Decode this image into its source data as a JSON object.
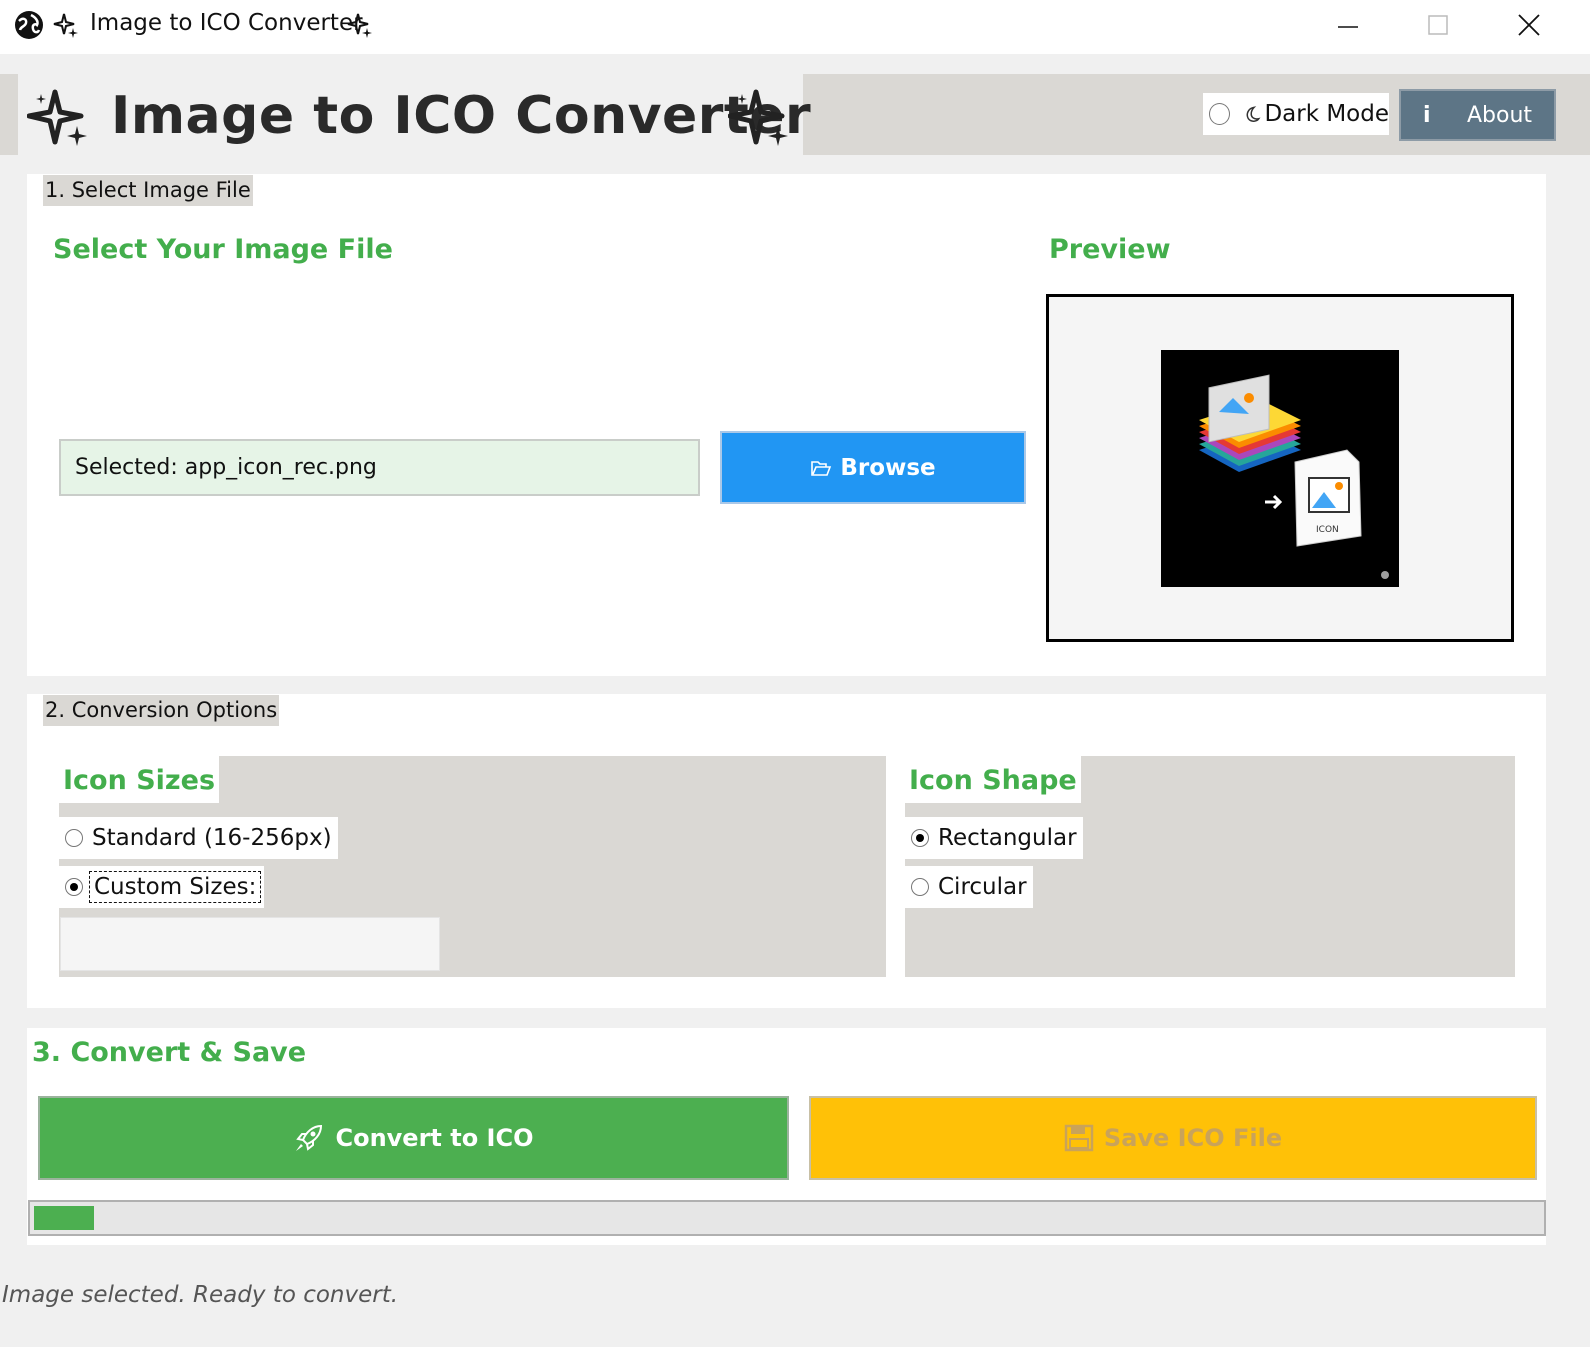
{
  "window": {
    "title": "Image to ICO Converter",
    "title_icon": "sparkle-icon",
    "app_icon": "globe-icon"
  },
  "header": {
    "title": "Image to ICO Converter",
    "dark_mode_label": "Dark Mode",
    "dark_mode_on": false,
    "about_icon_glyph": "i",
    "about_label": "About"
  },
  "section1": {
    "label": "1. Select Image File",
    "heading": "Select Your Image File",
    "file_field_value": "Selected: app_icon_rec.png",
    "browse_label": "Browse",
    "browse_icon": "folder-icon",
    "preview_heading": "Preview",
    "preview_icon_text": "ICON"
  },
  "section2": {
    "label": "2. Conversion Options",
    "sizes_heading": "Icon Sizes",
    "sizes_options": [
      {
        "label": "Standard (16-256px)",
        "selected": false
      },
      {
        "label": "Custom Sizes:",
        "selected": true
      }
    ],
    "custom_sizes_value": "",
    "shape_heading": "Icon Shape",
    "shape_options": [
      {
        "label": "Rectangular",
        "selected": true
      },
      {
        "label": "Circular",
        "selected": false
      }
    ]
  },
  "section3": {
    "heading": "3. Convert & Save",
    "convert_label": "Convert to ICO",
    "convert_icon": "rocket-icon",
    "save_label": "Save ICO File",
    "save_icon": "floppy-icon",
    "progress_fraction": 0.04
  },
  "status": "Image selected. Ready to convert.",
  "colors": {
    "accent_green": "#43ae4c",
    "convert_green": "#4caf50",
    "browse_blue": "#2196f3",
    "save_yellow": "#ffc107",
    "about_slate": "#5d7586",
    "panel_gray": "#dad8d4"
  }
}
